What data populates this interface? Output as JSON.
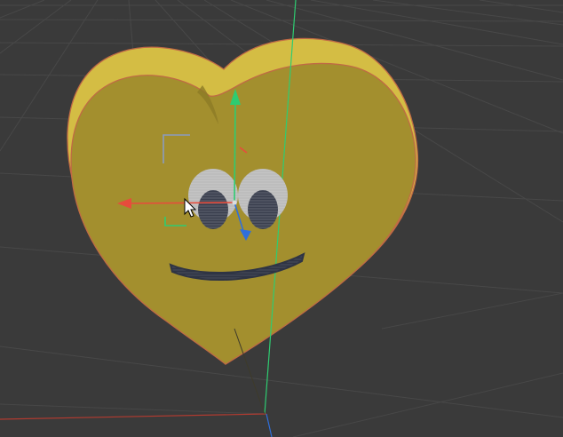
{
  "viewport": {
    "background": "#3a3a3a",
    "grid_color": "#4a4a4a",
    "axis_colors": {
      "x": "#c0392b",
      "y": "#2ecc71",
      "z": "#2f6fdb"
    }
  },
  "model": {
    "body_color": "#a6902f",
    "side_color": "#d6bf45",
    "outline_color": "#c4704a",
    "eye_color": "#c8c8c8",
    "pupil_color": "#3a3f4e",
    "mouth_color": "#2f3444"
  },
  "gizmo": {
    "x_color": "#e74c3c",
    "y_color": "#2ecc71",
    "z_color": "#2f6fdb"
  },
  "cursor": {
    "icon": "cursor-arrow-icon"
  }
}
